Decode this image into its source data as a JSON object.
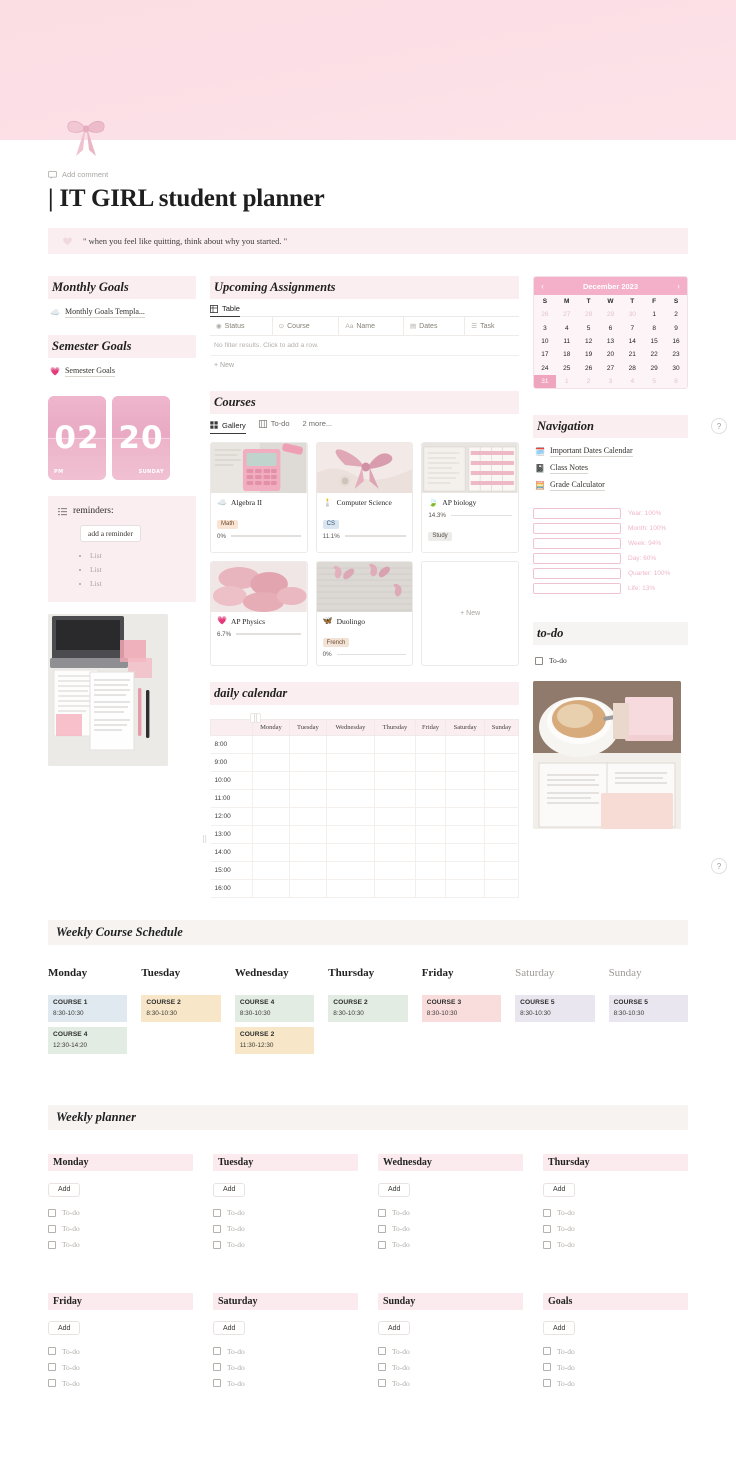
{
  "banner": {
    "icon": "bow-icon"
  },
  "header": {
    "add_comment": "Add comment",
    "title": "| IT GIRL student planner",
    "quote": "\" when you feel like quitting, think about why you started. \""
  },
  "left_column": {
    "monthly_goals_heading": "Monthly Goals",
    "monthly_goals_link": "Monthly Goals Templa...",
    "semester_goals_heading": "Semester Goals",
    "semester_goals_link": "Semester Goals",
    "clock": {
      "hour": "02",
      "meridiem": "PM",
      "day_num": "20",
      "weekday": "SUNDAY"
    },
    "reminders": {
      "title": "reminders:",
      "add_button": "add a reminder",
      "items": [
        "List",
        "List",
        "List"
      ]
    }
  },
  "assignments": {
    "heading": "Upcoming Assignments",
    "tabs": [
      {
        "label": "Table",
        "icon": "table-icon"
      }
    ],
    "columns": [
      {
        "label": "Status",
        "icon": "select-icon"
      },
      {
        "label": "Course",
        "icon": "relation-icon"
      },
      {
        "label": "Name",
        "icon": "text-icon"
      },
      {
        "label": "Dates",
        "icon": "date-icon"
      },
      {
        "label": "Task",
        "icon": "list-icon"
      }
    ],
    "empty_text": "No filter results. Click to add a row.",
    "new_row": "+  New"
  },
  "courses": {
    "heading": "Courses",
    "tabs": [
      {
        "label": "Gallery",
        "icon": "gallery-icon"
      },
      {
        "label": "To-do",
        "icon": "board-icon"
      },
      {
        "label": "2 more...",
        "icon": ""
      }
    ],
    "cards": [
      {
        "name": "Algebra II",
        "emoji": "☁️",
        "tag": "Math",
        "tag_class": "math",
        "pct": "0%",
        "pct_val": 0
      },
      {
        "name": "Computer Science",
        "emoji": "🕯️",
        "tag": "CS",
        "tag_class": "cs",
        "pct": "11.1%",
        "pct_val": 11.1
      },
      {
        "name": "AP biology",
        "emoji": "🍃",
        "tag": "Study",
        "tag_class": "study",
        "pct": "14.3%",
        "pct_val": 14.3,
        "pct_first": true
      },
      {
        "name": "AP Physics",
        "emoji": "💗",
        "tag": "",
        "tag_class": "",
        "pct": "6.7%",
        "pct_val": 6.7
      },
      {
        "name": "Duolingo",
        "emoji": "🦋",
        "tag": "French",
        "tag_class": "french",
        "pct": "0%",
        "pct_val": 0
      }
    ],
    "new_card": "+  New"
  },
  "daily_calendar": {
    "heading": "daily calendar",
    "days": [
      "Monday",
      "Tuesday",
      "Wednesday",
      "Thursday",
      "Friday",
      "Saturday",
      "Sunday"
    ],
    "hours": [
      "8:00",
      "9:00",
      "10:00",
      "11:00",
      "12:00",
      "13:00",
      "14:00",
      "15:00",
      "16:00"
    ]
  },
  "calendar_widget": {
    "month": "December 2023",
    "prev": "‹",
    "next": "›",
    "weekdays": [
      "S",
      "M",
      "T",
      "W",
      "T",
      "F",
      "S"
    ],
    "weeks": [
      [
        {
          "d": "26",
          "muted": true
        },
        {
          "d": "27",
          "muted": true
        },
        {
          "d": "28",
          "muted": true
        },
        {
          "d": "29",
          "muted": true
        },
        {
          "d": "30",
          "muted": true
        },
        {
          "d": "1"
        },
        {
          "d": "2"
        }
      ],
      [
        {
          "d": "3"
        },
        {
          "d": "4"
        },
        {
          "d": "5"
        },
        {
          "d": "6"
        },
        {
          "d": "7"
        },
        {
          "d": "8"
        },
        {
          "d": "9"
        }
      ],
      [
        {
          "d": "10"
        },
        {
          "d": "11"
        },
        {
          "d": "12"
        },
        {
          "d": "13"
        },
        {
          "d": "14"
        },
        {
          "d": "15"
        },
        {
          "d": "16"
        }
      ],
      [
        {
          "d": "17"
        },
        {
          "d": "18"
        },
        {
          "d": "19"
        },
        {
          "d": "20"
        },
        {
          "d": "21"
        },
        {
          "d": "22"
        },
        {
          "d": "23"
        }
      ],
      [
        {
          "d": "24"
        },
        {
          "d": "25"
        },
        {
          "d": "26"
        },
        {
          "d": "27"
        },
        {
          "d": "28"
        },
        {
          "d": "29"
        },
        {
          "d": "30"
        }
      ],
      [
        {
          "d": "31",
          "today": true
        },
        {
          "d": "1",
          "muted": true
        },
        {
          "d": "2",
          "muted": true
        },
        {
          "d": "3",
          "muted": true
        },
        {
          "d": "4",
          "muted": true
        },
        {
          "d": "5",
          "muted": true
        },
        {
          "d": "6",
          "muted": true
        }
      ]
    ]
  },
  "navigation": {
    "heading": "Navigation",
    "links": [
      {
        "label": "Important Dates Calendar",
        "emoji": "🗓️"
      },
      {
        "label": "Class Notes",
        "emoji": "📓"
      },
      {
        "label": "Grade Calculator",
        "emoji": "🧮"
      }
    ],
    "progress": [
      {
        "label": "Year: 100%",
        "value": 100
      },
      {
        "label": "Month: 100%",
        "value": 100
      },
      {
        "label": "Week: 94%",
        "value": 94
      },
      {
        "label": "Day: 60%",
        "value": 60
      },
      {
        "label": "Quarter: 100%",
        "value": 100
      },
      {
        "label": "Life: 13%",
        "value": 13
      }
    ]
  },
  "todo": {
    "heading": "to-do",
    "item": "To-do"
  },
  "weekly_course_schedule": {
    "heading": "Weekly Course Schedule",
    "days": [
      {
        "name": "Monday",
        "weekend": false,
        "slots": [
          {
            "course": "COURSE 1",
            "time": "8:30-10:30",
            "color": "c-blue"
          },
          {
            "course": "COURSE 4",
            "time": "12:30-14:20",
            "color": "c-green"
          }
        ]
      },
      {
        "name": "Tuesday",
        "weekend": false,
        "slots": [
          {
            "course": "COURSE 2",
            "time": "8:30-10:30",
            "color": "c-yellow"
          }
        ]
      },
      {
        "name": "Wednesday",
        "weekend": false,
        "slots": [
          {
            "course": "COURSE 4",
            "time": "8:30-10:30",
            "color": "c-green"
          },
          {
            "course": "COURSE 2",
            "time": "11:30-12:30",
            "color": "c-yellow"
          }
        ]
      },
      {
        "name": "Thursday",
        "weekend": false,
        "slots": [
          {
            "course": "COURSE 2",
            "time": "8:30-10:30",
            "color": "c-green"
          }
        ]
      },
      {
        "name": "Friday",
        "weekend": false,
        "slots": [
          {
            "course": "COURSE 3",
            "time": "8:30-10:30",
            "color": "c-pink"
          }
        ]
      },
      {
        "name": "Saturday",
        "weekend": true,
        "slots": [
          {
            "course": "COURSE 5",
            "time": "8:30-10:30",
            "color": "c-lav"
          }
        ]
      },
      {
        "name": "Sunday",
        "weekend": true,
        "slots": [
          {
            "course": "COURSE 5",
            "time": "8:30-10:30",
            "color": "c-lav"
          }
        ]
      }
    ]
  },
  "weekly_planner": {
    "heading": "Weekly planner",
    "add_label": "Add",
    "todo_label": "To-do",
    "columns": [
      {
        "day": "Monday",
        "todos": [
          "To-do",
          "To-do",
          "To-do"
        ]
      },
      {
        "day": "Tuesday",
        "todos": [
          "To-do",
          "To-do",
          "To-do"
        ]
      },
      {
        "day": "Wednesday",
        "todos": [
          "To-do",
          "To-do",
          "To-do"
        ]
      },
      {
        "day": "Thursday",
        "todos": [
          "To-do",
          "To-do",
          "To-do"
        ]
      },
      {
        "day": "Friday",
        "todos": [
          "To-do",
          "To-do",
          "To-do"
        ]
      },
      {
        "day": "Saturday",
        "todos": [
          "To-do",
          "To-do",
          "To-do"
        ]
      },
      {
        "day": "Sunday",
        "todos": [
          "To-do",
          "To-do",
          "To-do"
        ]
      },
      {
        "day": "Goals",
        "todos": [
          "To-do",
          "To-do",
          "To-do"
        ]
      }
    ]
  },
  "help_buttons": {
    "label": "?"
  },
  "colors": {
    "banner_pink": "#fbdde4",
    "accent_pink": "#f4adc4",
    "section_pink": "#fbeef1",
    "section_gray": "#f6f3f1"
  }
}
